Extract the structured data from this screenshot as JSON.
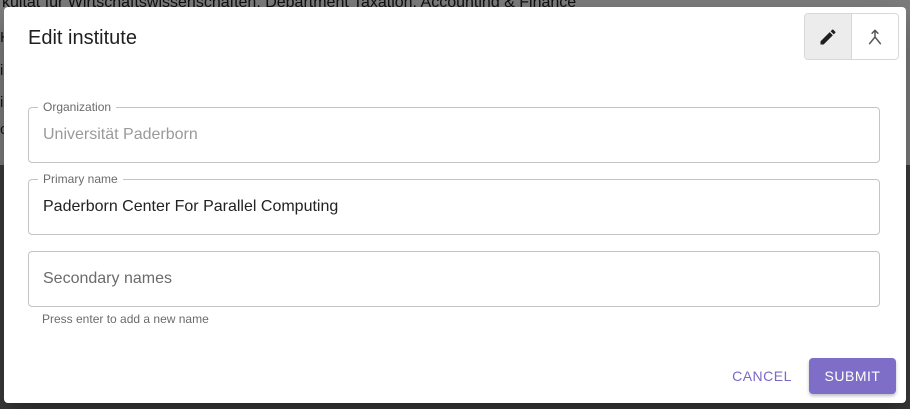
{
  "background": {
    "line1": "kultät für Wirtschaftswissenschaften, Department Taxation, Accounting & Finance",
    "fragments": [
      "K",
      "i",
      "i",
      "c"
    ]
  },
  "dialog": {
    "title": "Edit institute",
    "toggles": [
      {
        "icon": "pencil-icon",
        "selected": true
      },
      {
        "icon": "merge-icon",
        "selected": false
      }
    ],
    "fields": {
      "organization": {
        "label": "Organization",
        "value": "Universität Paderborn"
      },
      "primary_name": {
        "label": "Primary name",
        "value": "Paderborn Center For Parallel Computing"
      },
      "secondary_names": {
        "placeholder": "Secondary names",
        "helper": "Press enter to add a new name"
      }
    },
    "actions": {
      "cancel": "CANCEL",
      "submit": "SUBMIT"
    }
  },
  "colors": {
    "accent": "#7e6ec8",
    "cancel_text": "#7b68c8"
  }
}
